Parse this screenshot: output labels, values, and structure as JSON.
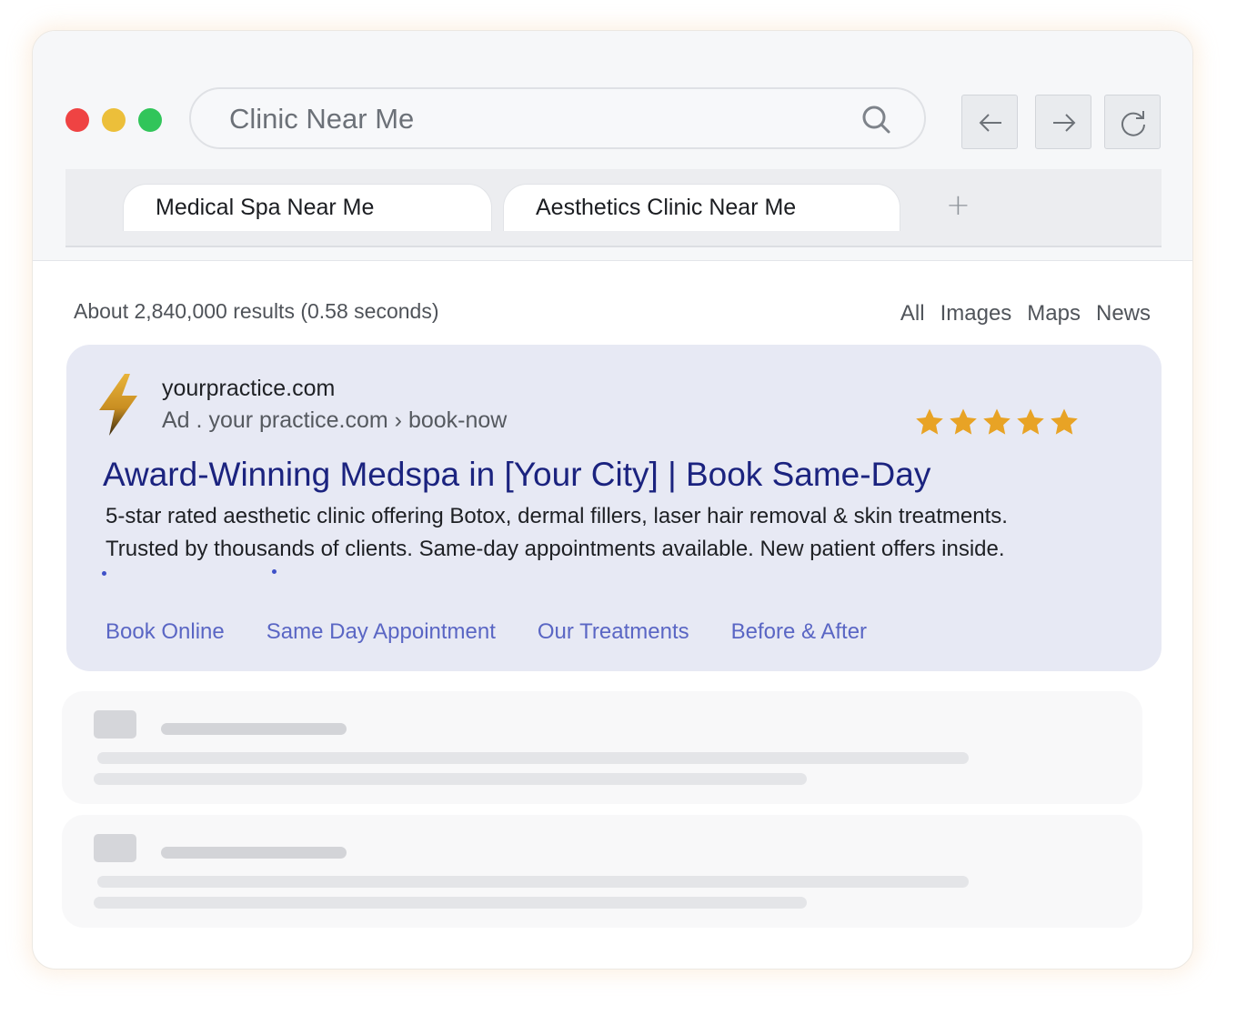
{
  "browser": {
    "search_query": "Clinic Near Me",
    "tabs": [
      {
        "label": "Medical Spa Near Me"
      },
      {
        "label": "Aesthetics Clinic Near Me"
      }
    ],
    "new_tab_label": "+"
  },
  "results": {
    "count_text": "About 2,840,000 results (0.58 seconds)",
    "filters": [
      "All",
      "Images",
      "Maps",
      "News"
    ]
  },
  "ad": {
    "domain": "yourpractice.com",
    "label": "Ad .",
    "breadcrumb": "your practice.com › book-now",
    "rating_stars": 5,
    "headline": "Award-Winning Medspa in [Your City] | Book Same-Day",
    "description": "5-star rated aesthetic clinic offering Botox, dermal fillers, laser hair removal & skin treatments. Trusted by thousands of clients. Same-day appointments available. New patient offers inside.",
    "sitelinks": [
      "Book Online",
      "Same Day Appointment",
      "Our Treatments",
      "Before & After"
    ]
  },
  "colors": {
    "headline": "#1b237f",
    "sitelink": "#5a66c4",
    "star": "#e8a325",
    "ad_background": "#e7e9f4"
  },
  "icons": {
    "logo": "lightning-bolt-icon",
    "search": "search-icon",
    "back": "arrow-left-icon",
    "forward": "arrow-right-icon",
    "reload": "reload-icon",
    "rating": "star-icon"
  }
}
